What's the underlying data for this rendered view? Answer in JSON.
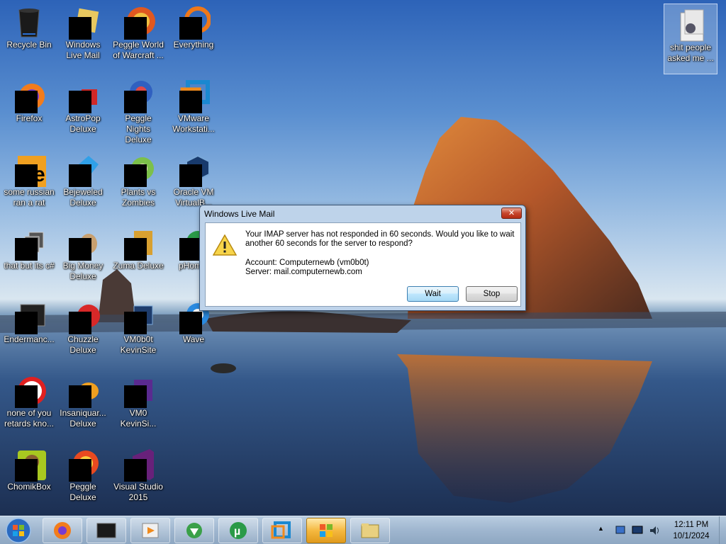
{
  "desktop": {
    "icons": [
      {
        "label": "Recycle Bin",
        "icon": "recycle-bin-icon"
      },
      {
        "label": "Windows Live Mail",
        "icon": "windows-live-mail-icon"
      },
      {
        "label": "Peggle World of Warcraft ...",
        "icon": "peggle-wow-icon"
      },
      {
        "label": "Everything",
        "icon": "everything-icon"
      },
      {
        "label": "Firefox",
        "icon": "firefox-icon"
      },
      {
        "label": "AstroPop Deluxe",
        "icon": "astropop-icon"
      },
      {
        "label": "Peggle Nights Deluxe",
        "icon": "peggle-nights-icon"
      },
      {
        "label": "VMware Workstati...",
        "icon": "vmware-icon"
      },
      {
        "label": "some russian ran a rat",
        "icon": "russian-rat-icon"
      },
      {
        "label": "Bejeweled Deluxe",
        "icon": "bejeweled-icon"
      },
      {
        "label": "Plants vs Zombies",
        "icon": "plants-vs-zombies-icon"
      },
      {
        "label": "Oracle VM VirtualB...",
        "icon": "virtualbox-icon"
      },
      {
        "label": "that but its c#",
        "icon": "shortcut-icon"
      },
      {
        "label": "Big Money Deluxe",
        "icon": "big-money-icon"
      },
      {
        "label": "Zuma Deluxe",
        "icon": "zuma-icon"
      },
      {
        "label": "pHom...",
        "icon": "app-icon"
      },
      {
        "label": "Endermanc...",
        "icon": "endermanch-icon"
      },
      {
        "label": "Chuzzle Deluxe",
        "icon": "chuzzle-icon"
      },
      {
        "label": "VM0b0t KevinSite",
        "icon": "vm-kevinsite-icon"
      },
      {
        "label": "Wave",
        "icon": "wave-icon"
      },
      {
        "label": "none of you retards kno...",
        "icon": "none-of-you-icon"
      },
      {
        "label": "Insaniquar... Deluxe",
        "icon": "insaniquarium-icon"
      },
      {
        "label": "VM0 KevinSi...",
        "icon": "vm-kevinsi-icon"
      },
      {
        "label": "ChomikBox",
        "icon": "chomikbox-icon"
      },
      {
        "label": "Peggle Deluxe",
        "icon": "peggle-deluxe-icon"
      },
      {
        "label": "Visual Studio 2015",
        "icon": "visual-studio-icon"
      },
      {
        "label": "shit people asked me ...",
        "icon": "folder-icon"
      }
    ]
  },
  "dialog": {
    "title": "Windows Live Mail",
    "close_glyph": "✕",
    "message": "Your IMAP server has not responded in 60 seconds. Would you like to wait another 60 seconds for the server to respond?",
    "account": "Account: Computernewb (vm0b0t)",
    "server": "Server: mail.computernewb.com",
    "wait_label": "Wait",
    "stop_label": "Stop"
  },
  "taskbar": {
    "items": [
      {
        "name": "firefox-icon"
      },
      {
        "name": "terminal-icon"
      },
      {
        "name": "media-player-icon"
      },
      {
        "name": "download-manager-icon"
      },
      {
        "name": "utorrent-icon"
      },
      {
        "name": "virtualbox-icon"
      },
      {
        "name": "windows-explorer-icon"
      },
      {
        "name": "folder-icon"
      }
    ],
    "time": "12:11 PM",
    "date": "10/1/2024",
    "tray_chevron": "▲"
  },
  "colors": {
    "dialog_frame": "#bed3ea",
    "taskbar": "#9fb6cf",
    "close_button": "#c7462d"
  }
}
